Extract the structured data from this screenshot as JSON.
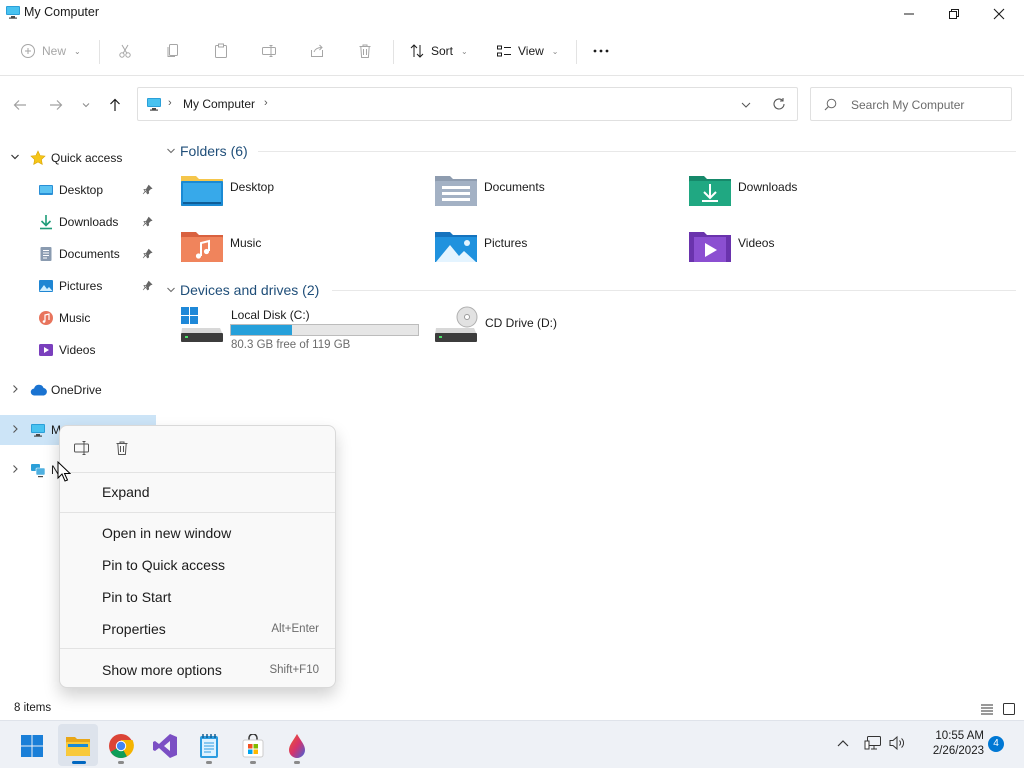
{
  "window": {
    "title": "My Computer",
    "minimize_icon": "minimize-icon",
    "maximize_icon": "restore-icon",
    "close_icon": "close-icon"
  },
  "toolbar": {
    "new_label": "New",
    "sort_label": "Sort",
    "view_label": "View",
    "more_icon": "ellipsis-icon",
    "disabled_icons": [
      "cut-icon",
      "copy-icon",
      "paste-icon",
      "rename-icon",
      "share-icon",
      "delete-icon"
    ]
  },
  "address": {
    "breadcrumb_root_icon": "computer-icon",
    "breadcrumb": [
      "My Computer"
    ]
  },
  "search": {
    "placeholder": "Search My Computer"
  },
  "sidebar": {
    "quick_access": "Quick access",
    "items": [
      {
        "label": "Desktop",
        "pinned": true
      },
      {
        "label": "Downloads",
        "pinned": true
      },
      {
        "label": "Documents",
        "pinned": true
      },
      {
        "label": "Pictures",
        "pinned": true
      },
      {
        "label": "Music",
        "pinned": false
      },
      {
        "label": "Videos",
        "pinned": false
      }
    ],
    "onedrive": "OneDrive",
    "this_pc_partial": "M",
    "network_partial": "N"
  },
  "content": {
    "folders_header": "Folders (6)",
    "folders": [
      "Desktop",
      "Documents",
      "Downloads",
      "Music",
      "Pictures",
      "Videos"
    ],
    "devices_header": "Devices and drives (2)",
    "drives": [
      {
        "name": "Local Disk (C:)",
        "free_text": "80.3 GB free of 119 GB",
        "used_fraction": 0.325
      },
      {
        "name": "CD Drive (D:)"
      }
    ]
  },
  "context_menu": {
    "items": [
      {
        "label": "Expand",
        "shortcut": ""
      },
      {
        "label": "Open in new window",
        "shortcut": ""
      },
      {
        "label": "Pin to Quick access",
        "shortcut": ""
      },
      {
        "label": "Pin to Start",
        "shortcut": ""
      },
      {
        "label": "Properties",
        "shortcut": "Alt+Enter"
      },
      {
        "label": "Show more options",
        "shortcut": "Shift+F10"
      }
    ]
  },
  "status": {
    "items_count": "8 items"
  },
  "taskbar": {
    "time": "10:55 AM",
    "date": "2/26/2023",
    "notification_count": "4",
    "colors": {
      "accent": "#0078d4",
      "drive_bar": "#26a0da"
    }
  }
}
